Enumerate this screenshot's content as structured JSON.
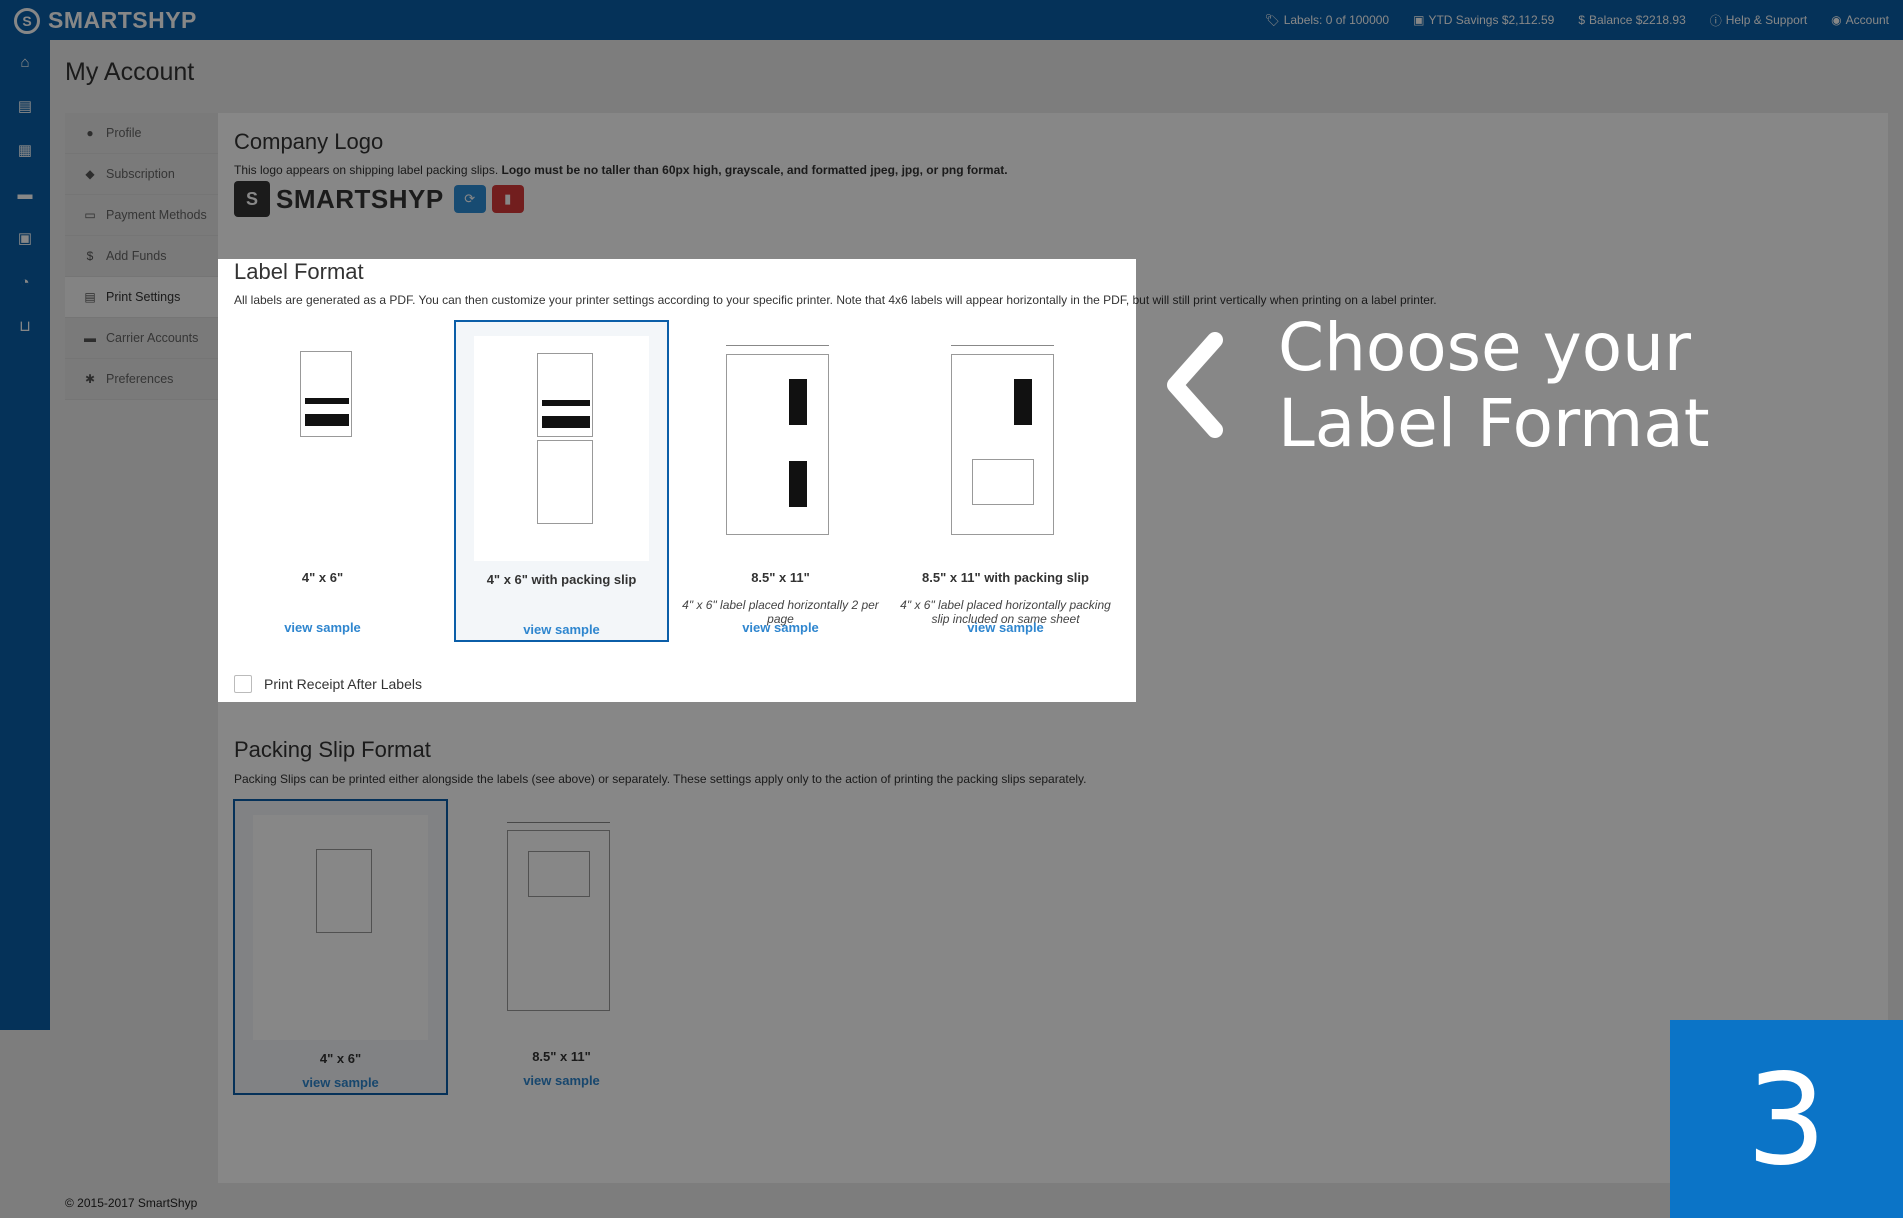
{
  "topbar": {
    "brand": "SMARTSHYP",
    "labels": "Labels: 0 of 100000",
    "ytd_savings": "YTD Savings $2,112.59",
    "balance": "Balance $2218.93",
    "help": "Help & Support",
    "account": "Account"
  },
  "page": {
    "title": "My Account"
  },
  "side_menu": {
    "items": [
      {
        "label": "Profile",
        "icon": "user-icon"
      },
      {
        "label": "Subscription",
        "icon": "tag-icon"
      },
      {
        "label": "Payment Methods",
        "icon": "credit-card-icon"
      },
      {
        "label": "Add Funds",
        "icon": "dollar-icon"
      },
      {
        "label": "Print Settings",
        "icon": "printer-icon",
        "active": true
      },
      {
        "label": "Carrier Accounts",
        "icon": "truck-icon"
      },
      {
        "label": "Preferences",
        "icon": "gears-icon"
      }
    ]
  },
  "company_logo": {
    "title": "Company Logo",
    "desc": "This logo appears on shipping label packing slips.",
    "desc_bold": "Logo must be no taller than 60px high, grayscale, and formatted jpeg, jpg, or png format.",
    "logo_text": "SMARTSHYP"
  },
  "label_format": {
    "title": "Label Format",
    "desc": "All labels are generated as a PDF. You can then customize your printer settings according to your specific printer. Note that 4x6 labels will appear horizontally in the PDF, but will still print vertically when printing on a label printer.",
    "options": [
      {
        "name": "4\" x 6\"",
        "note": "",
        "link": "view sample"
      },
      {
        "name": "4\" x 6\" with packing slip",
        "note": "",
        "link": "view sample",
        "selected": true
      },
      {
        "name": "8.5\" x 11\"",
        "note": "4\" x 6\" label placed horizontally 2 per page",
        "link": "view sample"
      },
      {
        "name": "8.5\" x 11\" with packing slip",
        "note": "4\" x 6\" label placed horizontally packing slip included on same sheet",
        "link": "view sample"
      }
    ],
    "receipt_label": "Print Receipt After Labels"
  },
  "packing_slip": {
    "title": "Packing Slip Format",
    "desc": "Packing Slips can be printed either alongside the labels (see above) or separately. These settings apply only to the action of printing the packing slips separately.",
    "options": [
      {
        "name": "4\" x 6\"",
        "link": "view sample",
        "selected": true
      },
      {
        "name": "8.5\" x 11\"",
        "link": "view sample"
      }
    ]
  },
  "callout": {
    "line1": "Choose your",
    "line2": "Label Format"
  },
  "step": "3",
  "footer": "© 2015-2017 SmartShyp",
  "colors": {
    "primary": "#0a5fa8",
    "step_box": "#0b74c7",
    "link": "#2f86cf"
  }
}
